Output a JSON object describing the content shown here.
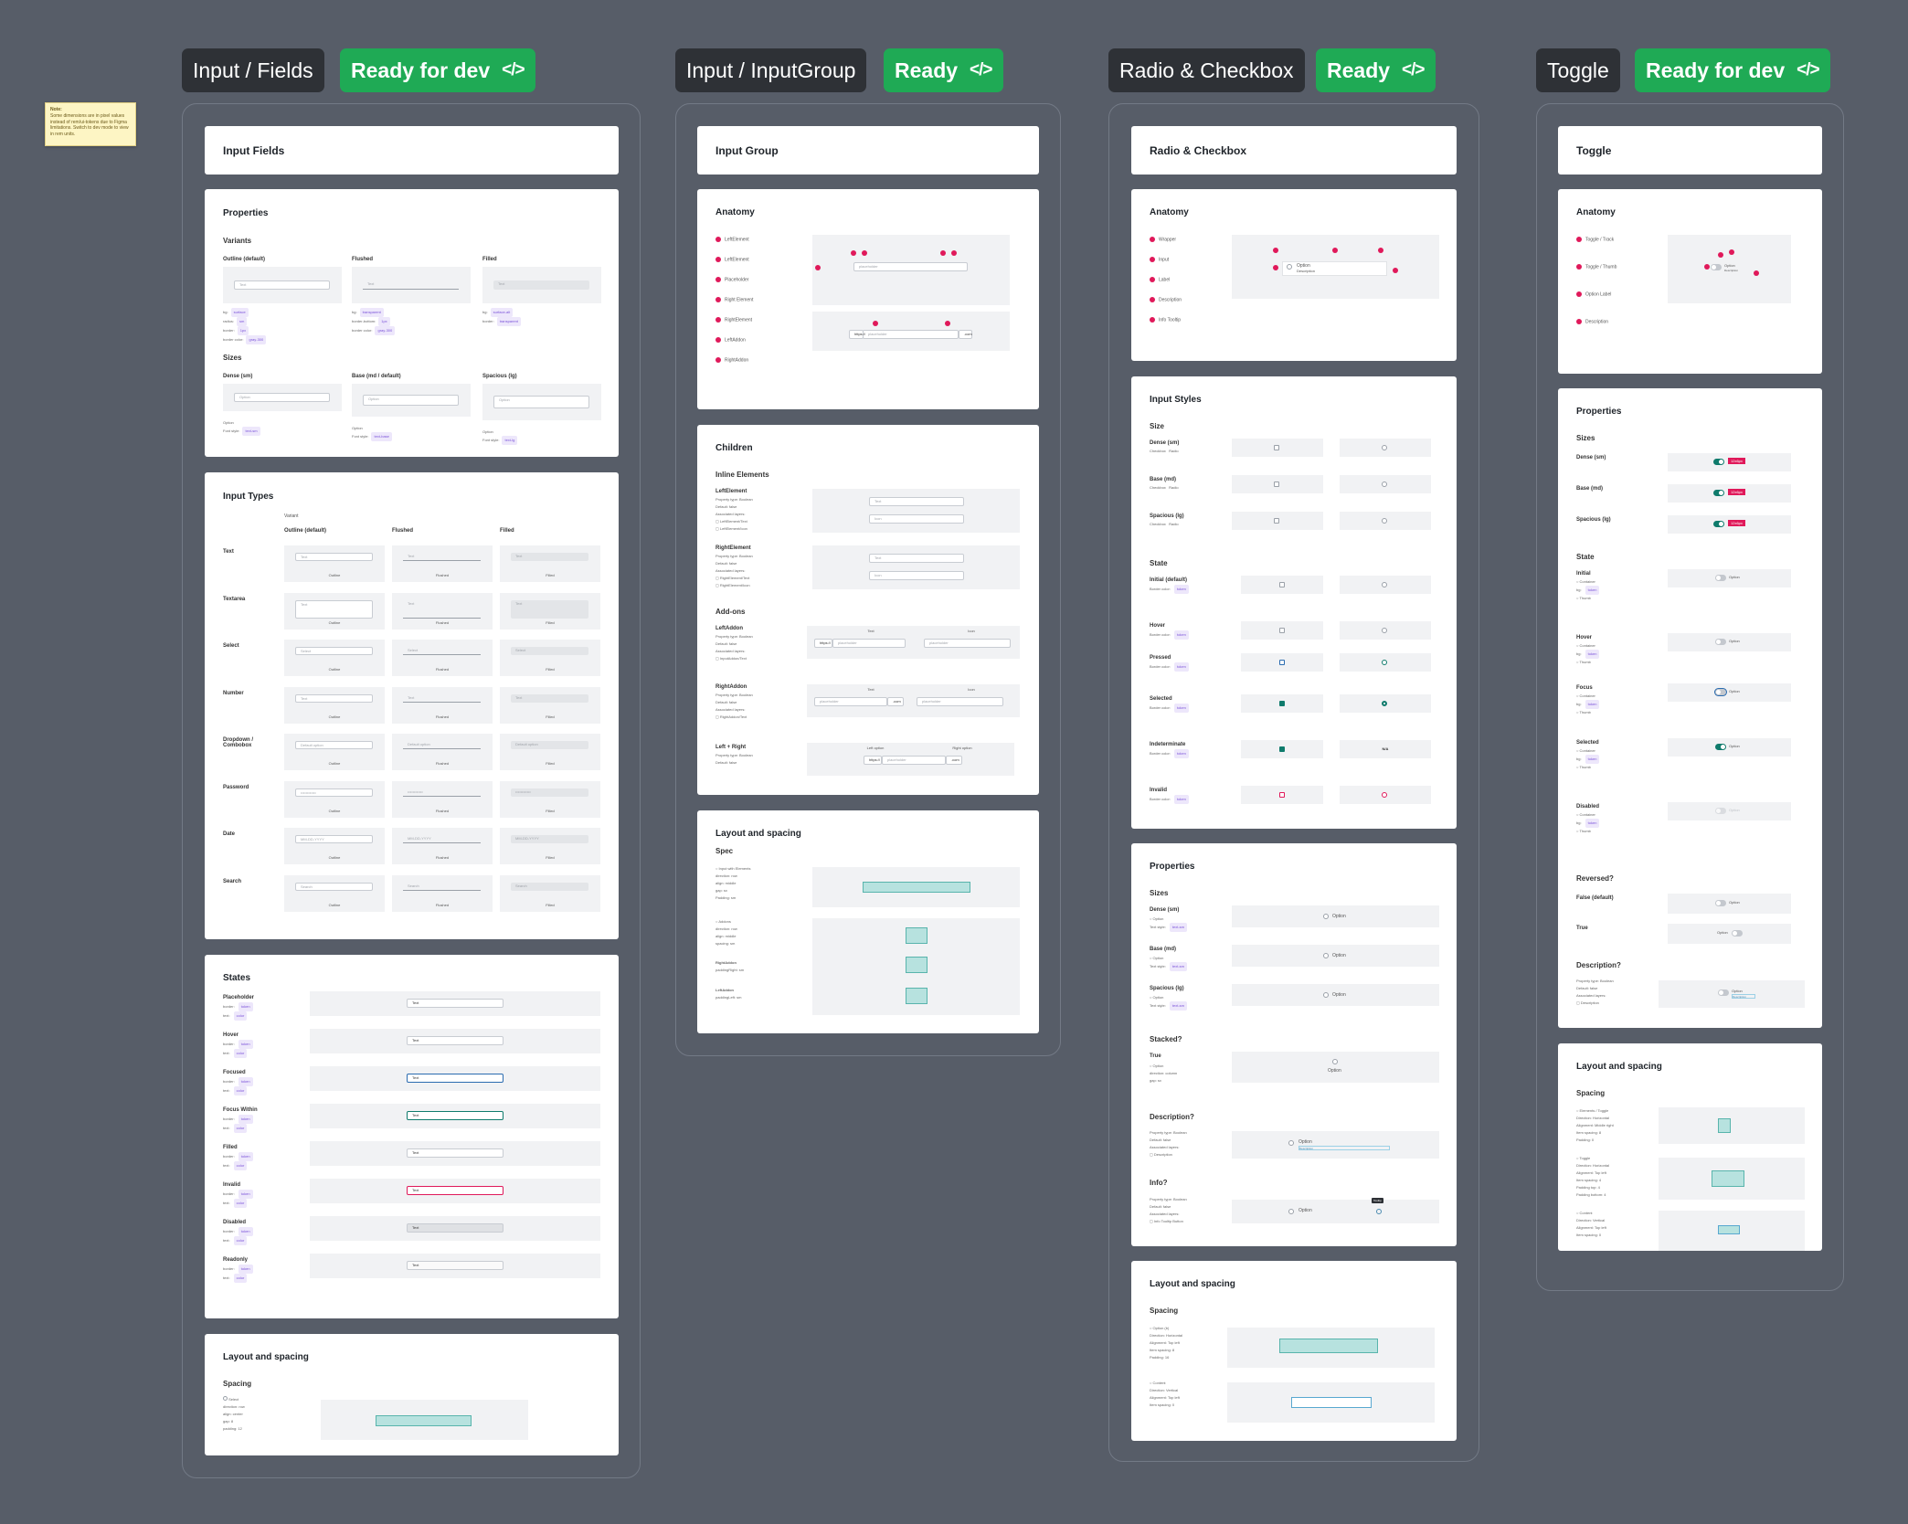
{
  "columns": [
    {
      "title": "Input / Fields",
      "status": "Ready for dev",
      "code_icon": "</>"
    },
    {
      "title": "Input / InputGroup",
      "status": "Ready",
      "code_icon": "</>"
    },
    {
      "title": "Radio & Checkbox",
      "status": "Ready",
      "code_icon": "</>"
    },
    {
      "title": "Toggle",
      "status": "Ready for dev",
      "code_icon": "</>"
    }
  ],
  "note": {
    "title": "Note:",
    "body": "Some dimensions are in pixel values instead of rem/ui-tokens due to Figma limitations. Switch to dev mode to view in rem units."
  },
  "fields": {
    "title": "Input Fields",
    "properties": {
      "heading": "Properties",
      "variants_label": "Variants",
      "variants": [
        "Outline (default)",
        "Flushed",
        "Filled"
      ],
      "placeholder": "Text",
      "sizes_label": "Sizes",
      "sizes": [
        "Dense (sm)",
        "Base (md / default)",
        "Spacious (lg)"
      ],
      "size_value": "Option",
      "option": "Option"
    },
    "types": {
      "heading": "Input Types",
      "variant_label": "Variant",
      "columns": [
        "Outline (default)",
        "Flushed",
        "Filled"
      ],
      "captions": [
        "Outline",
        "Flushed",
        "Filled"
      ],
      "rows": [
        "Text",
        "Textarea",
        "Select",
        "Number",
        "Dropdown / Combobox",
        "Password",
        "Date",
        "Search"
      ],
      "values": [
        "Text",
        "Text",
        "Select",
        "Text",
        "Default option",
        "••••••••••••",
        "MM-DD-YYYY",
        "Search"
      ]
    },
    "states": {
      "heading": "States",
      "rows": [
        "Placeholder",
        "Hover",
        "Focused",
        "Focus Within",
        "Filled",
        "Invalid",
        "Disabled",
        "Readonly"
      ],
      "value": "Text"
    },
    "layout": {
      "heading": "Layout and spacing",
      "sub": "Spacing",
      "item": "Select",
      "item_meta": [
        "direction: row",
        "align: center",
        "gap: 8",
        "padding: 12"
      ]
    }
  },
  "group": {
    "title": "Input Group",
    "anatomy": {
      "heading": "Anatomy",
      "items": [
        "LeftElement",
        "LeftElement",
        "Placeholder",
        "Right Element",
        "RightElement",
        "LeftAddon",
        "RightAddon"
      ],
      "addon_left": "https://",
      "addon_right": ".com",
      "placeholder": "placeholder"
    },
    "children": {
      "heading": "Children",
      "inline_label": "Inline Elements",
      "items": [
        "LeftElement",
        "RightElement"
      ],
      "addons_label": "Add-ons",
      "addons": [
        "LeftAddon",
        "RightAddon",
        "Left + Right"
      ],
      "text_label": "Text",
      "icon_label": "Icon",
      "left_option": "Left option",
      "right_option": "Right option",
      "addon_left": "https://",
      "addon_right": ".com",
      "placeholder": "placeholder"
    },
    "layout": {
      "heading": "Layout and spacing",
      "sub": "Spec",
      "items": [
        "Input with Elements",
        "Addons",
        "RightAddon",
        "LeftAddon"
      ]
    }
  },
  "radio": {
    "title": "Radio & Checkbox",
    "anatomy": {
      "heading": "Anatomy",
      "items": [
        "Wrapper",
        "Input",
        "Label",
        "Description",
        "Info Tooltip"
      ],
      "option": "Option",
      "description": "Description"
    },
    "styles": {
      "heading": "Input Styles",
      "size_label": "Size",
      "sizes": [
        "Dense (sm)",
        "Base (md)",
        "Spacious (lg)"
      ],
      "size_cols": [
        "Checkbox",
        "Radio"
      ],
      "state_label": "State",
      "states": [
        "Initial (default)",
        "Hover",
        "Pressed",
        "Selected",
        "Indeterminate",
        "Invalid"
      ],
      "na": "N/A"
    },
    "properties": {
      "heading": "Properties",
      "sizes_label": "Sizes",
      "sizes": [
        "Dense (sm)",
        "Base (md)",
        "Spacious (lg)"
      ],
      "option": "Option",
      "stacked_label": "Stacked?",
      "true_label": "True",
      "description_label": "Description?",
      "description": "Description",
      "info_label": "Info?",
      "info_item": "Info Tooltip Button",
      "tooltip": "Tooltip"
    },
    "layout": {
      "heading": "Layout and spacing",
      "sub": "Spacing",
      "items": [
        "Option (b)",
        "Content"
      ]
    }
  },
  "toggle": {
    "title": "Toggle",
    "anatomy": {
      "heading": "Anatomy",
      "items": [
        "Toggle / Track",
        "Toggle / Thumb",
        "Option Label",
        "Description"
      ],
      "option": "Option",
      "description": "Description"
    },
    "properties": {
      "heading": "Properties",
      "sizes_label": "Sizes",
      "sizes": [
        "Dense (sm)",
        "Base (md)",
        "Spacious (lg)"
      ],
      "size_tag": "12x6px",
      "state_label": "State",
      "states": [
        "Initial",
        "Hover",
        "Focus",
        "Selected",
        "Disabled"
      ],
      "option": "Option",
      "reversed_label": "Reversed?",
      "false_label": "False (default)",
      "true_label": "True",
      "description_label": "Description?",
      "description": "Description"
    },
    "layout": {
      "heading": "Layout and spacing",
      "sub": "Spacing",
      "items": [
        "Elements / Toggle",
        "Toggle",
        "Content"
      ]
    }
  },
  "colors": {
    "ready": "#1faa55",
    "dark_pill": "#2e3136",
    "canvas": "#575d68",
    "marker": "#e0195a",
    "tag": "#7b53d9",
    "toggle_on": "#0f7b6c"
  }
}
